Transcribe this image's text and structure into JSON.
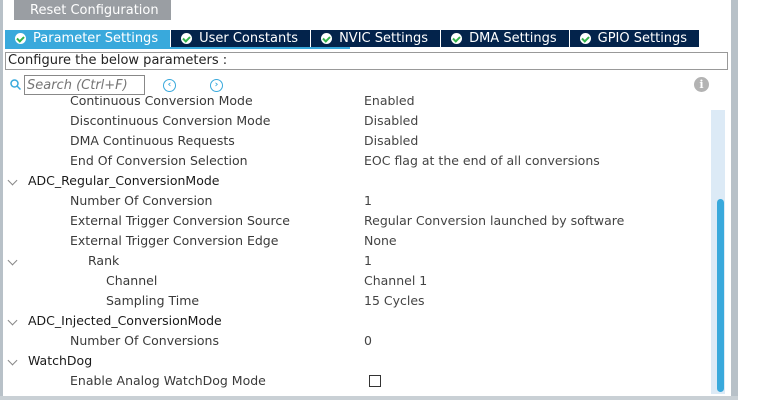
{
  "toolbar": {
    "reset_label": "Reset Configuration"
  },
  "tabs": [
    {
      "label": "Parameter Settings",
      "active": true
    },
    {
      "label": "User Constants"
    },
    {
      "label": "NVIC Settings"
    },
    {
      "label": "DMA Settings"
    },
    {
      "label": "GPIO Settings"
    }
  ],
  "configure_label": "Configure the below parameters :",
  "search": {
    "placeholder": "Search (Ctrl+F)",
    "prev": "‹",
    "next": "›",
    "info": "i"
  },
  "rows": [
    {
      "label": "Continuous Conversion Mode",
      "value": "Enabled"
    },
    {
      "label": "Discontinuous Conversion Mode",
      "value": "Disabled"
    },
    {
      "label": "DMA Continuous Requests",
      "value": "Disabled"
    },
    {
      "label": "End Of Conversion Selection",
      "value": "EOC flag at the end of all conversions"
    },
    {
      "label": "ADC_Regular_ConversionMode",
      "value": ""
    },
    {
      "label": "Number Of Conversion",
      "value": "1"
    },
    {
      "label": "External Trigger Conversion Source",
      "value": "Regular Conversion launched by software"
    },
    {
      "label": "External Trigger Conversion Edge",
      "value": "None"
    },
    {
      "label": "Rank",
      "value": "1"
    },
    {
      "label": "Channel",
      "value": "Channel 1"
    },
    {
      "label": "Sampling Time",
      "value": "15 Cycles"
    },
    {
      "label": "ADC_Injected_ConversionMode",
      "value": ""
    },
    {
      "label": "Number Of Conversions",
      "value": "0"
    },
    {
      "label": "WatchDog",
      "value": ""
    },
    {
      "label": "Enable Analog WatchDog Mode",
      "value": ""
    }
  ],
  "colors": {
    "accent": "#39a9dc",
    "tab_dark": "#03234b"
  }
}
